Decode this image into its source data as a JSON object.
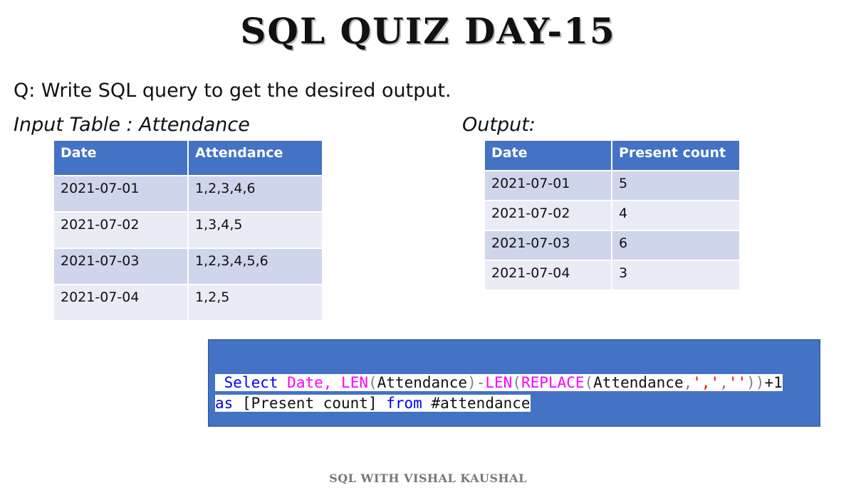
{
  "title": "SQL QUIZ DAY-15",
  "question": "Q: Write SQL query to get the desired output.",
  "input_label": "Input Table : Attendance",
  "output_label": "Output:",
  "input_table": {
    "headers": [
      "Date",
      "Attendance"
    ],
    "rows": [
      [
        "2021-07-01",
        "1,2,3,4,6"
      ],
      [
        "2021-07-02",
        "1,3,4,5"
      ],
      [
        "2021-07-03",
        "1,2,3,4,5,6"
      ],
      [
        "2021-07-04",
        "1,2,5"
      ]
    ]
  },
  "output_table": {
    "headers": [
      "Date",
      "Present count"
    ],
    "rows": [
      [
        "2021-07-01",
        "5"
      ],
      [
        "2021-07-02",
        "4"
      ],
      [
        "2021-07-03",
        "6"
      ],
      [
        "2021-07-04",
        "3"
      ]
    ]
  },
  "code": {
    "line1": [
      {
        "t": " ",
        "c": "tx"
      },
      {
        "t": "Select",
        "c": "kw"
      },
      {
        "t": " ",
        "c": "tx"
      },
      {
        "t": "Date,",
        "c": "fn"
      },
      {
        "t": " ",
        "c": "tx"
      },
      {
        "t": "LEN",
        "c": "fn"
      },
      {
        "t": "(",
        "c": "op"
      },
      {
        "t": "Attendance",
        "c": "tx"
      },
      {
        "t": ")",
        "c": "op"
      },
      {
        "t": "-",
        "c": "op"
      },
      {
        "t": "LEN",
        "c": "fn"
      },
      {
        "t": "(",
        "c": "op"
      },
      {
        "t": "REPLACE",
        "c": "fn"
      },
      {
        "t": "(",
        "c": "op"
      },
      {
        "t": "Attendance",
        "c": "tx"
      },
      {
        "t": ",",
        "c": "op"
      },
      {
        "t": "','",
        "c": "st"
      },
      {
        "t": ",",
        "c": "op"
      },
      {
        "t": "''",
        "c": "st"
      },
      {
        "t": "))",
        "c": "op"
      },
      {
        "t": "+1",
        "c": "tx"
      }
    ],
    "line2": [
      {
        "t": "as",
        "c": "kw"
      },
      {
        "t": " [Present count] ",
        "c": "tx"
      },
      {
        "t": "from",
        "c": "kw"
      },
      {
        "t": " #attendance",
        "c": "tx"
      }
    ]
  },
  "footer": "SQL WITH VISHAL KAUSHAL",
  "colors": {
    "header_blue": "#4472c4",
    "row_dark": "#cfd5ea",
    "row_light": "#e9ebf5",
    "sql_keyword": "#0000ff",
    "sql_function": "#ff00ff",
    "sql_string": "#ff0000",
    "sql_operator": "#808080"
  }
}
